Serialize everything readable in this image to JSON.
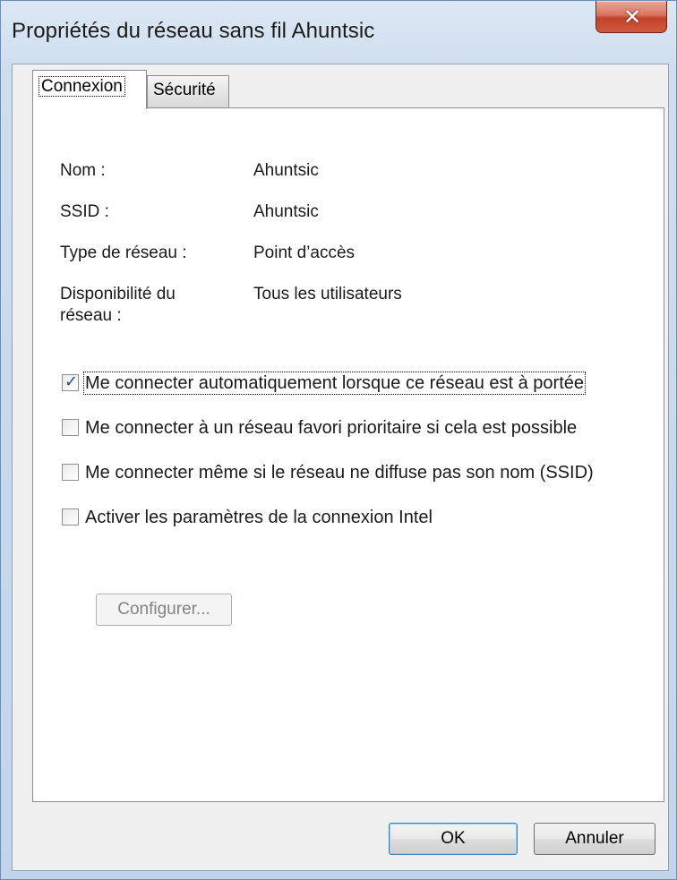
{
  "window": {
    "title": "Propriétés du réseau sans fil Ahuntsic",
    "close_icon": "close-icon"
  },
  "tabs": [
    {
      "label": "Connexion",
      "selected": true
    },
    {
      "label": "Sécurité",
      "selected": false
    }
  ],
  "info": [
    {
      "label": "Nom :",
      "value": "Ahuntsic"
    },
    {
      "label": "SSID :",
      "value": "Ahuntsic"
    },
    {
      "label": "Type de réseau :",
      "value": "Point d’accès"
    },
    {
      "label": "Disponibilité du réseau :",
      "value": "Tous les utilisateurs"
    }
  ],
  "options": [
    {
      "label": "Me connecter automatiquement lorsque ce réseau est à portée",
      "checked": true
    },
    {
      "label": "Me connecter à un réseau favori prioritaire si cela est possible",
      "checked": false
    },
    {
      "label": "Me connecter même si le réseau ne diffuse pas son nom (SSID)",
      "checked": false
    },
    {
      "label": "Activer les paramètres de la connexion Intel",
      "checked": false
    }
  ],
  "configure_label": "Configurer...",
  "buttons": {
    "ok": "OK",
    "cancel": "Annuler"
  },
  "colors": {
    "close_button": "#c2412a",
    "checkmark": "#2a4b8c",
    "ok_border": "#3c7fb1"
  }
}
